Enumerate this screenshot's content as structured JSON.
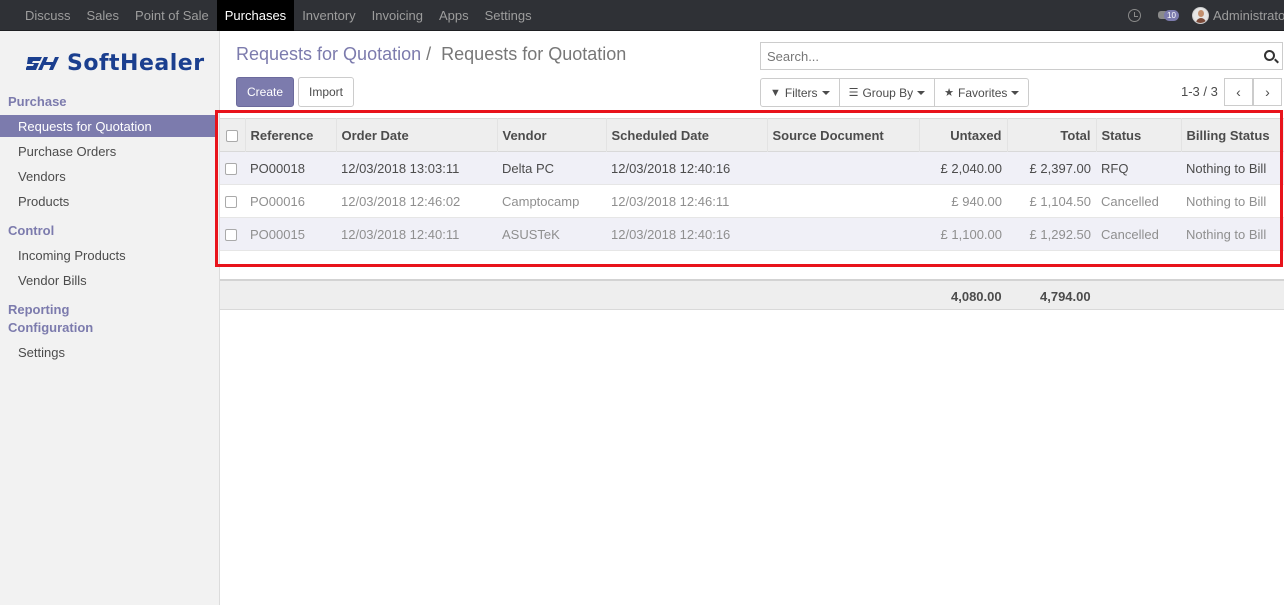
{
  "topnav": {
    "items": [
      "Discuss",
      "Sales",
      "Point of Sale",
      "Purchases",
      "Inventory",
      "Invoicing",
      "Apps",
      "Settings"
    ],
    "active": "Purchases",
    "chat_badge": "10",
    "user": "Administrator"
  },
  "sidebar": {
    "logo_text": "SoftHealer",
    "sections": [
      {
        "title": "Purchase",
        "items": [
          "Requests for Quotation",
          "Purchase Orders",
          "Vendors",
          "Products"
        ]
      },
      {
        "title": "Control",
        "items": [
          "Incoming Products",
          "Vendor Bills"
        ]
      },
      {
        "title": "Reporting",
        "items": []
      },
      {
        "title": "Configuration",
        "items": [
          "Settings"
        ]
      }
    ],
    "active_item": "Requests for Quotation"
  },
  "header": {
    "breadcrumb_parent": "Requests for Quotation",
    "breadcrumb_sep": "/",
    "breadcrumb_current": "Requests for Quotation",
    "create_label": "Create",
    "import_label": "Import",
    "search_placeholder": "Search...",
    "filters_label": "Filters",
    "groupby_label": "Group By",
    "favorites_label": "Favorites",
    "pager": "1-3 / 3"
  },
  "table": {
    "columns": [
      "Reference",
      "Order Date",
      "Vendor",
      "Scheduled Date",
      "Source Document",
      "Untaxed",
      "Total",
      "Status",
      "Billing Status"
    ],
    "rows": [
      {
        "ref": "PO00018",
        "order_date": "12/03/2018 13:03:11",
        "vendor": "Delta PC",
        "scheduled": "12/03/2018 12:40:16",
        "source": "",
        "untaxed": "£ 2,040.00",
        "total": "£ 2,397.00",
        "status": "RFQ",
        "billing": "Nothing to Bill"
      },
      {
        "ref": "PO00016",
        "order_date": "12/03/2018 12:46:02",
        "vendor": "Camptocamp",
        "scheduled": "12/03/2018 12:46:11",
        "source": "",
        "untaxed": "£ 940.00",
        "total": "£ 1,104.50",
        "status": "Cancelled",
        "billing": "Nothing to Bill"
      },
      {
        "ref": "PO00015",
        "order_date": "12/03/2018 12:40:11",
        "vendor": "ASUSTeK",
        "scheduled": "12/03/2018 12:40:16",
        "source": "",
        "untaxed": "£ 1,100.00",
        "total": "£ 1,292.50",
        "status": "Cancelled",
        "billing": "Nothing to Bill"
      }
    ],
    "sum_untaxed": "4,080.00",
    "sum_total": "4,794.00"
  },
  "colors": {
    "brand": "#7c7bad",
    "navbar": "#2f3136",
    "highlight": "#e8131b",
    "logo": "#1b3f8f"
  }
}
